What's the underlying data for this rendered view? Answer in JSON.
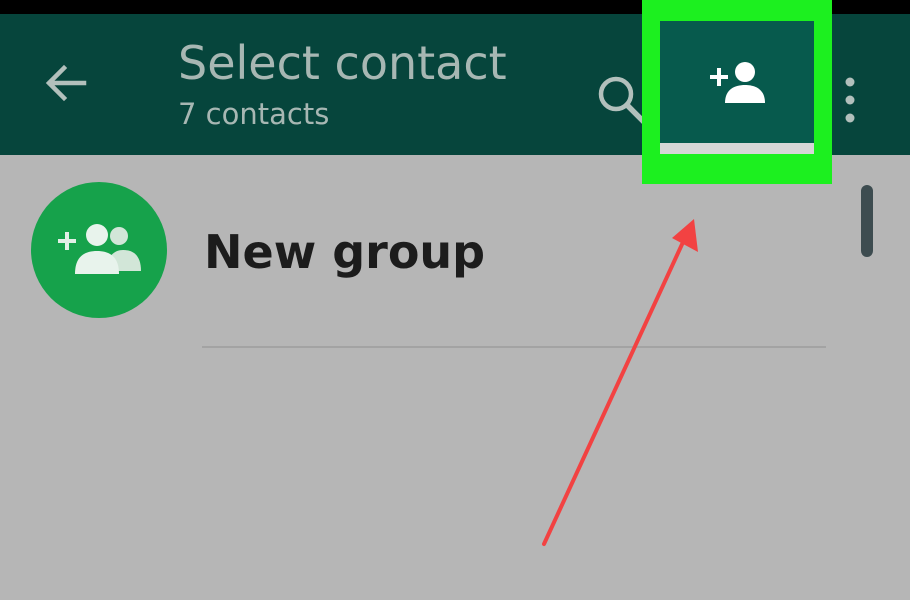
{
  "header": {
    "title": "Select contact",
    "subtitle": "7 contacts",
    "back_icon": "arrow-left-icon",
    "search_icon": "search-icon",
    "add_contact_icon": "add-person-icon",
    "more_icon": "more-vertical-icon"
  },
  "list": {
    "items": [
      {
        "label": "New group",
        "icon": "add-group-icon"
      }
    ]
  },
  "colors": {
    "app_bar": "#06453c",
    "highlight": "#1cf01f",
    "avatar": "#16a24b",
    "arrow": "#f24242"
  }
}
